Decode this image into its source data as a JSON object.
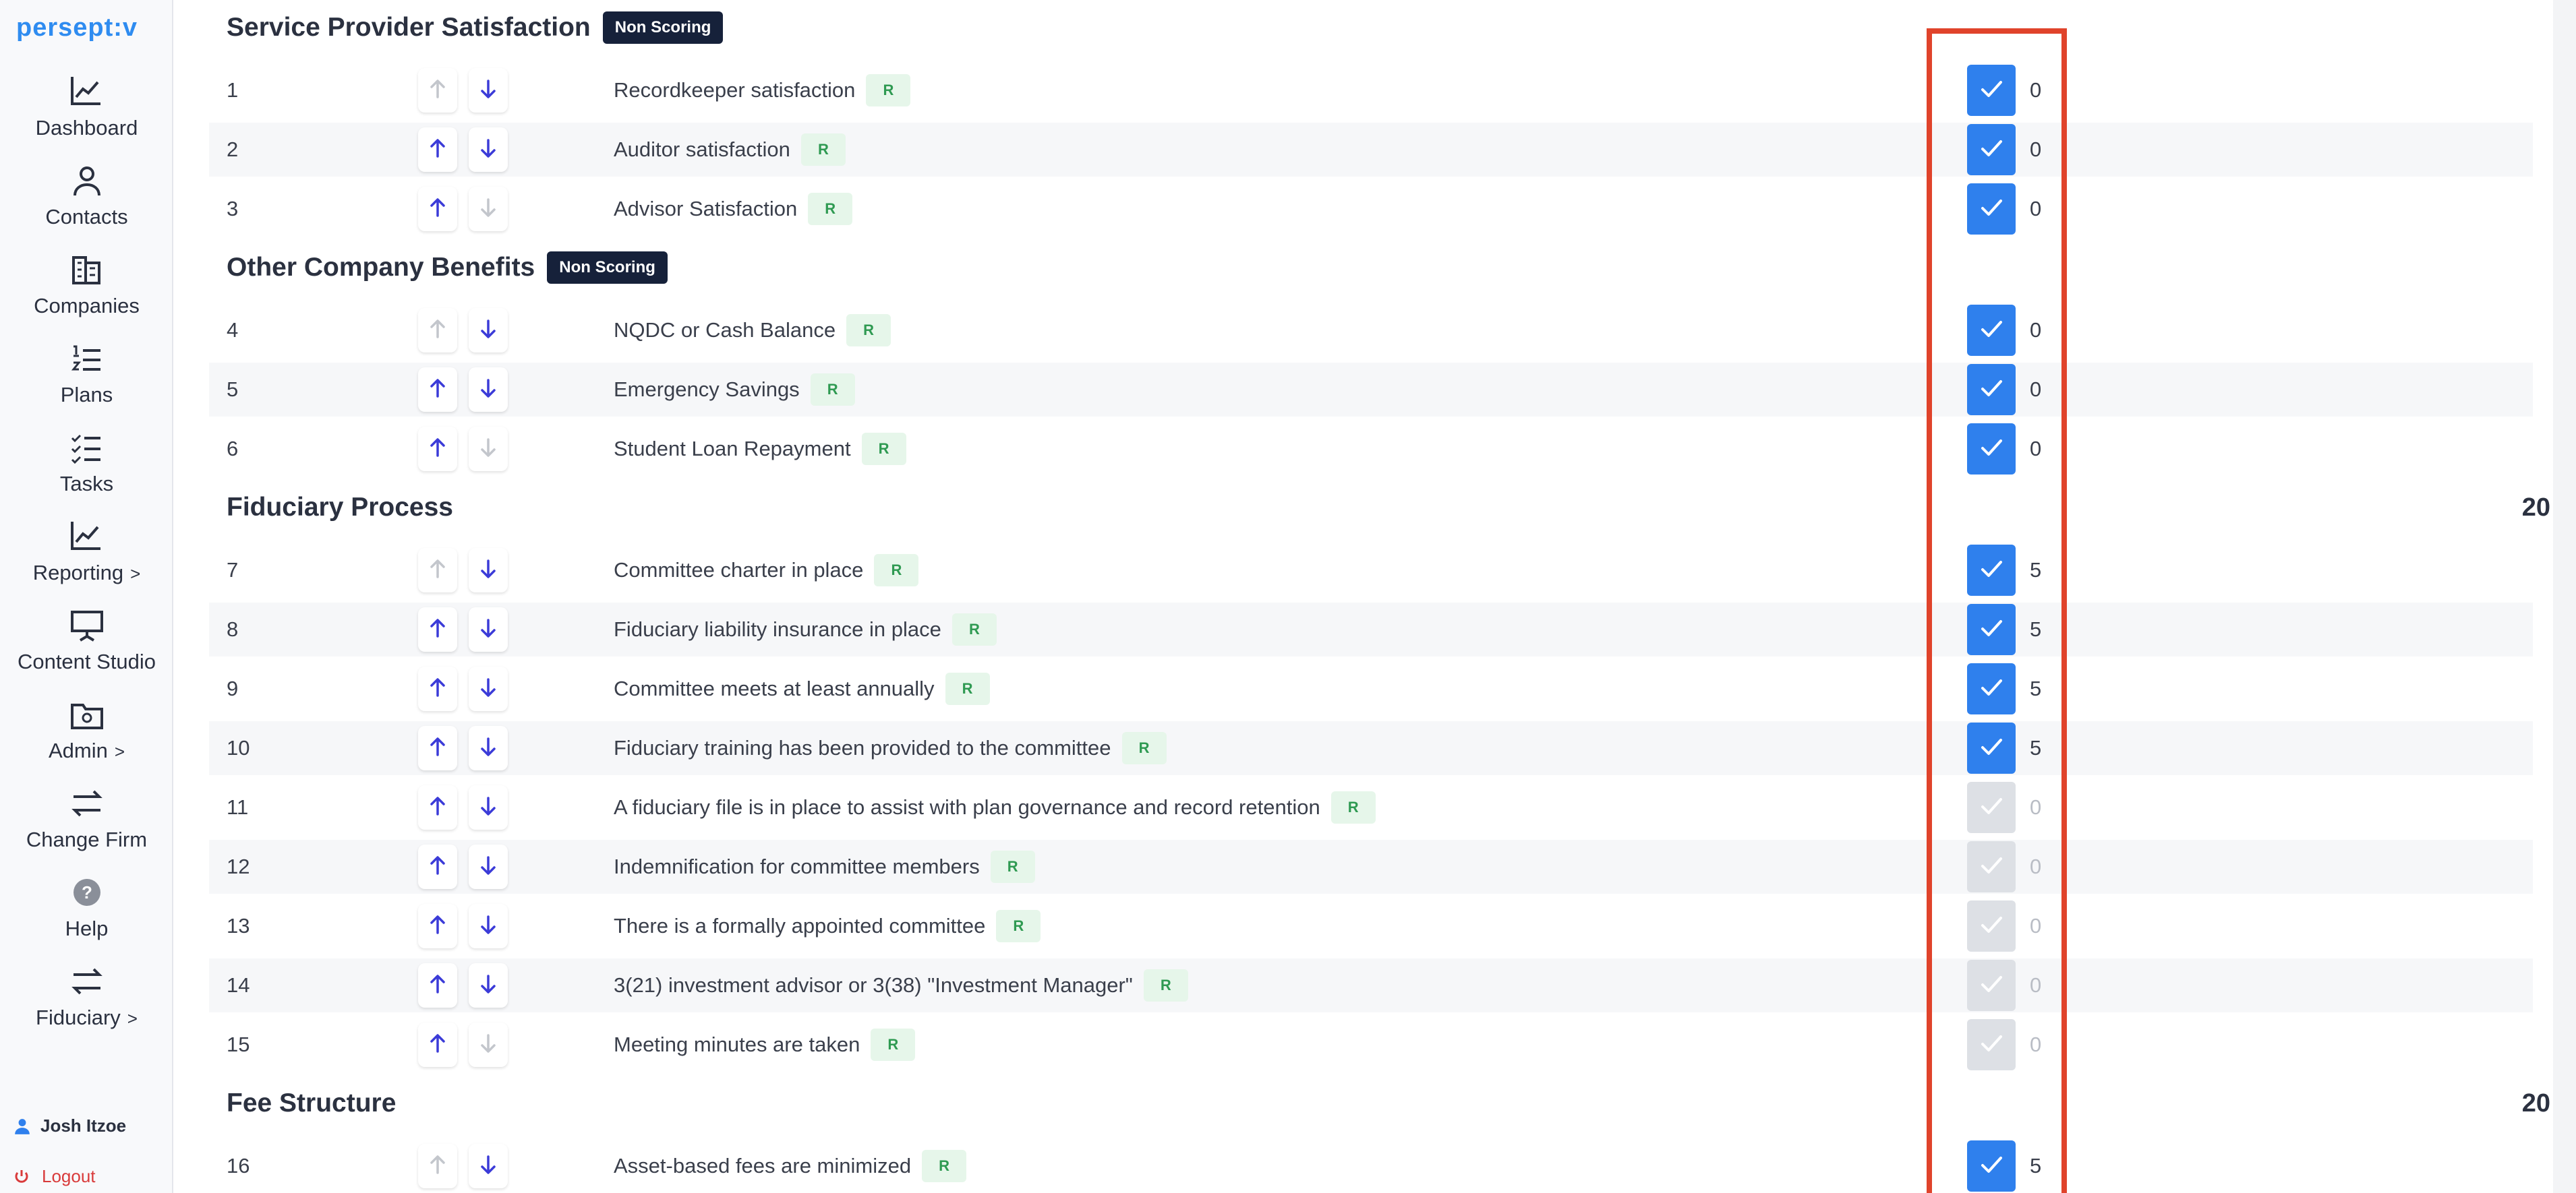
{
  "brand": {
    "logo": "persept:v"
  },
  "sidebar": {
    "items": [
      {
        "label": "Dashboard",
        "icon": "chart-line-icon"
      },
      {
        "label": "Contacts",
        "icon": "user-icon"
      },
      {
        "label": "Companies",
        "icon": "building-icon"
      },
      {
        "label": "Plans",
        "icon": "numbered-list-icon"
      },
      {
        "label": "Tasks",
        "icon": "task-list-icon"
      },
      {
        "label": "Reporting",
        "icon": "chart-line-icon",
        "chevron": ">"
      },
      {
        "label": "Content Studio",
        "icon": "presentation-icon"
      },
      {
        "label": "Admin",
        "icon": "folder-gear-icon",
        "chevron": ">"
      },
      {
        "label": "Change Firm",
        "icon": "swap-icon"
      },
      {
        "label": "Help",
        "icon": "help-icon",
        "glyph": "?"
      },
      {
        "label": "Fiduciary",
        "icon": "swap-icon",
        "chevron": ">"
      }
    ],
    "user": "Josh Itzoe",
    "logout": "Logout"
  },
  "sections": [
    {
      "title": "Service Provider Satisfaction",
      "badge": "Non Scoring",
      "total": "",
      "rows": [
        {
          "num": "1",
          "label": "Recordkeeper satisfaction",
          "tag": "R",
          "up": false,
          "down": true,
          "checked": true,
          "score": "0"
        },
        {
          "num": "2",
          "label": "Auditor satisfaction",
          "tag": "R",
          "up": true,
          "down": true,
          "checked": true,
          "score": "0"
        },
        {
          "num": "3",
          "label": "Advisor Satisfaction",
          "tag": "R",
          "up": true,
          "down": false,
          "checked": true,
          "score": "0"
        }
      ]
    },
    {
      "title": "Other Company Benefits",
      "badge": "Non Scoring",
      "total": "",
      "rows": [
        {
          "num": "4",
          "label": "NQDC or Cash Balance",
          "tag": "R",
          "up": false,
          "down": true,
          "checked": true,
          "score": "0"
        },
        {
          "num": "5",
          "label": "Emergency Savings",
          "tag": "R",
          "up": true,
          "down": true,
          "checked": true,
          "score": "0"
        },
        {
          "num": "6",
          "label": "Student Loan Repayment",
          "tag": "R",
          "up": true,
          "down": false,
          "checked": true,
          "score": "0"
        }
      ]
    },
    {
      "title": "Fiduciary Process",
      "badge": "",
      "total": "20",
      "rows": [
        {
          "num": "7",
          "label": "Committee charter in place",
          "tag": "R",
          "up": false,
          "down": true,
          "checked": true,
          "score": "5"
        },
        {
          "num": "8",
          "label": "Fiduciary liability insurance in place",
          "tag": "R",
          "up": true,
          "down": true,
          "checked": true,
          "score": "5"
        },
        {
          "num": "9",
          "label": "Committee meets at least annually",
          "tag": "R",
          "up": true,
          "down": true,
          "checked": true,
          "score": "5"
        },
        {
          "num": "10",
          "label": "Fiduciary training has been provided to the committee",
          "tag": "R",
          "up": true,
          "down": true,
          "checked": true,
          "score": "5"
        },
        {
          "num": "11",
          "label": "A fiduciary file is in place to assist with plan governance and record retention",
          "tag": "R",
          "up": true,
          "down": true,
          "checked": false,
          "score": "0"
        },
        {
          "num": "12",
          "label": "Indemnification for committee members",
          "tag": "R",
          "up": true,
          "down": true,
          "checked": false,
          "score": "0"
        },
        {
          "num": "13",
          "label": "There is a formally appointed committee",
          "tag": "R",
          "up": true,
          "down": true,
          "checked": false,
          "score": "0"
        },
        {
          "num": "14",
          "label": "3(21) investment advisor or 3(38) \"Investment Manager\"",
          "tag": "R",
          "up": true,
          "down": true,
          "checked": false,
          "score": "0"
        },
        {
          "num": "15",
          "label": "Meeting minutes are taken",
          "tag": "R",
          "up": true,
          "down": false,
          "checked": false,
          "score": "0"
        }
      ]
    },
    {
      "title": "Fee Structure",
      "badge": "",
      "total": "20",
      "rows": [
        {
          "num": "16",
          "label": "Asset-based fees are minimized",
          "tag": "R",
          "up": false,
          "down": true,
          "checked": true,
          "score": "5"
        }
      ]
    }
  ],
  "colors": {
    "accent": "#2f80ed",
    "arrow_active": "#3b3bd8",
    "arrow_disabled": "#c3c6cc",
    "badge_dark": "#16213a",
    "tag_bg": "#e6f6ea",
    "tag_text": "#2f9a52",
    "highlight": "#e0432b"
  }
}
